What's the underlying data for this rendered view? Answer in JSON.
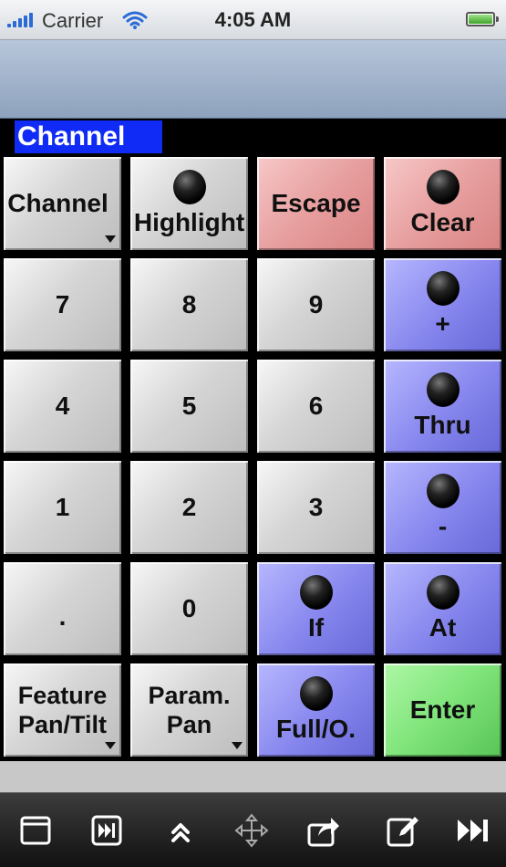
{
  "status_bar": {
    "carrier": "Carrier",
    "time": "4:05 AM",
    "signal_icon": "signal-bars-icon",
    "wifi_icon": "wifi-icon",
    "battery_icon": "battery-icon"
  },
  "mode_label": "Channel",
  "keys": {
    "channel": "Channel",
    "highlight": "Highlight",
    "escape": "Escape",
    "clear": "Clear",
    "seven": "7",
    "eight": "8",
    "nine": "9",
    "plus": "+",
    "four": "4",
    "five": "5",
    "six": "6",
    "thru": "Thru",
    "one": "1",
    "two": "2",
    "three": "3",
    "minus": "-",
    "dot": ".",
    "zero": "0",
    "if": "If",
    "at": "At",
    "feature_line1": "Feature",
    "feature_line2": "Pan/Tilt",
    "param_line1": "Param.",
    "param_line2": "Pan",
    "full": "Full/O.",
    "enter": "Enter"
  },
  "colors": {
    "mode_label_bg": "#0f2bf5",
    "gray_key": "#d5d5d5",
    "red_key": "#e79f9f",
    "blue_key": "#8686ee",
    "green_key": "#7fe47a"
  },
  "toolbar": {
    "icons": [
      "window-icon",
      "skip-forward-icon",
      "double-chevron-up-icon",
      "move-arrows-icon",
      "share-icon",
      "edit-icon",
      "fast-forward-icon"
    ]
  }
}
